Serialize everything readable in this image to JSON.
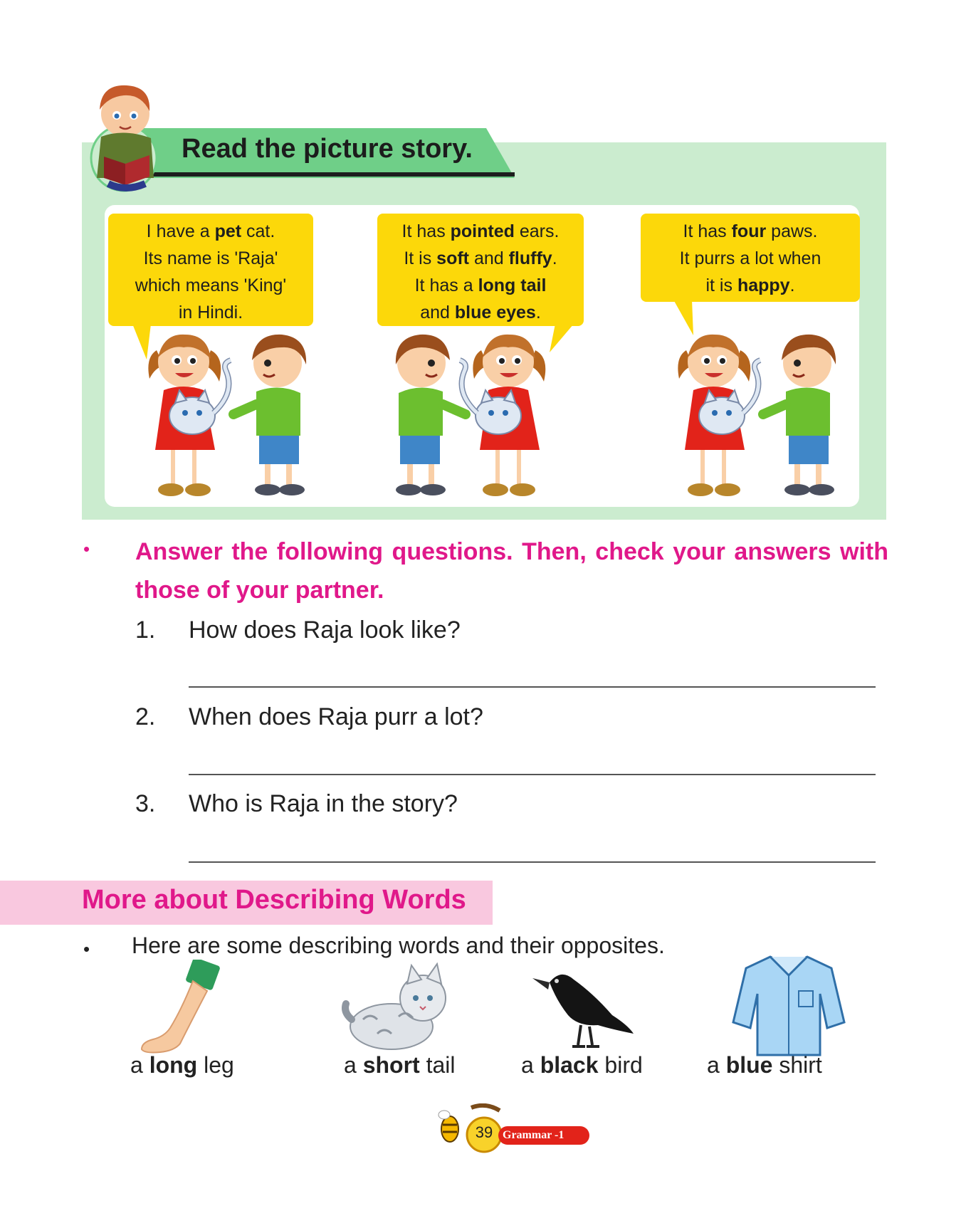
{
  "story": {
    "title": "Read the picture story.",
    "bubbles": [
      {
        "lines": [
          [
            {
              "t": "I have a "
            },
            {
              "t": "pet",
              "b": true
            },
            {
              "t": " cat."
            }
          ],
          [
            {
              "t": "Its name is 'Raja'"
            }
          ],
          [
            {
              "t": "which means 'King'"
            }
          ],
          [
            {
              "t": "in Hindi."
            }
          ]
        ]
      },
      {
        "lines": [
          [
            {
              "t": "It has "
            },
            {
              "t": "pointed",
              "b": true
            },
            {
              "t": " ears."
            }
          ],
          [
            {
              "t": "It is "
            },
            {
              "t": "soft",
              "b": true
            },
            {
              "t": " and "
            },
            {
              "t": "fluffy",
              "b": true
            },
            {
              "t": "."
            }
          ],
          [
            {
              "t": "It has a "
            },
            {
              "t": "long tail",
              "b": true
            }
          ],
          [
            {
              "t": "and "
            },
            {
              "t": "blue eyes",
              "b": true
            },
            {
              "t": "."
            }
          ]
        ]
      },
      {
        "lines": [
          [
            {
              "t": "It has "
            },
            {
              "t": "four",
              "b": true
            },
            {
              "t": " paws."
            }
          ],
          [
            {
              "t": "It purrs a lot when"
            }
          ],
          [
            {
              "t": "it is "
            },
            {
              "t": "happy",
              "b": true
            },
            {
              "t": "."
            }
          ]
        ]
      }
    ]
  },
  "questions": {
    "bullet": "•",
    "instruction": "Answer the following questions. Then, check your answers with those of your partner.",
    "items": [
      {
        "num": "1.",
        "text": "How does Raja look like?"
      },
      {
        "num": "2.",
        "text": "When does Raja purr a lot?"
      },
      {
        "num": "3.",
        "text": "Who is Raja in the story?"
      }
    ]
  },
  "describing": {
    "title": "More about Describing Words",
    "bullet": "•",
    "intro": "Here are some describing words and their opposites.",
    "items": [
      {
        "pre": "a ",
        "word": "long",
        "post": " leg",
        "icon": "leg-icon"
      },
      {
        "pre": "a ",
        "word": "short",
        "post": " tail",
        "icon": "cat-icon"
      },
      {
        "pre": "a ",
        "word": "black",
        "post": " bird",
        "icon": "crow-icon"
      },
      {
        "pre": "a ",
        "word": "blue",
        "post": " shirt",
        "icon": "shirt-icon"
      }
    ]
  },
  "footer": {
    "page_number": "39",
    "book": "Grammar -1"
  },
  "colors": {
    "panel_green": "#cbeccf",
    "banner_green": "#6fcf88",
    "bubble_yellow": "#fcd80a",
    "accent_pink": "#e0188a",
    "band_pink": "#f9c8df"
  }
}
